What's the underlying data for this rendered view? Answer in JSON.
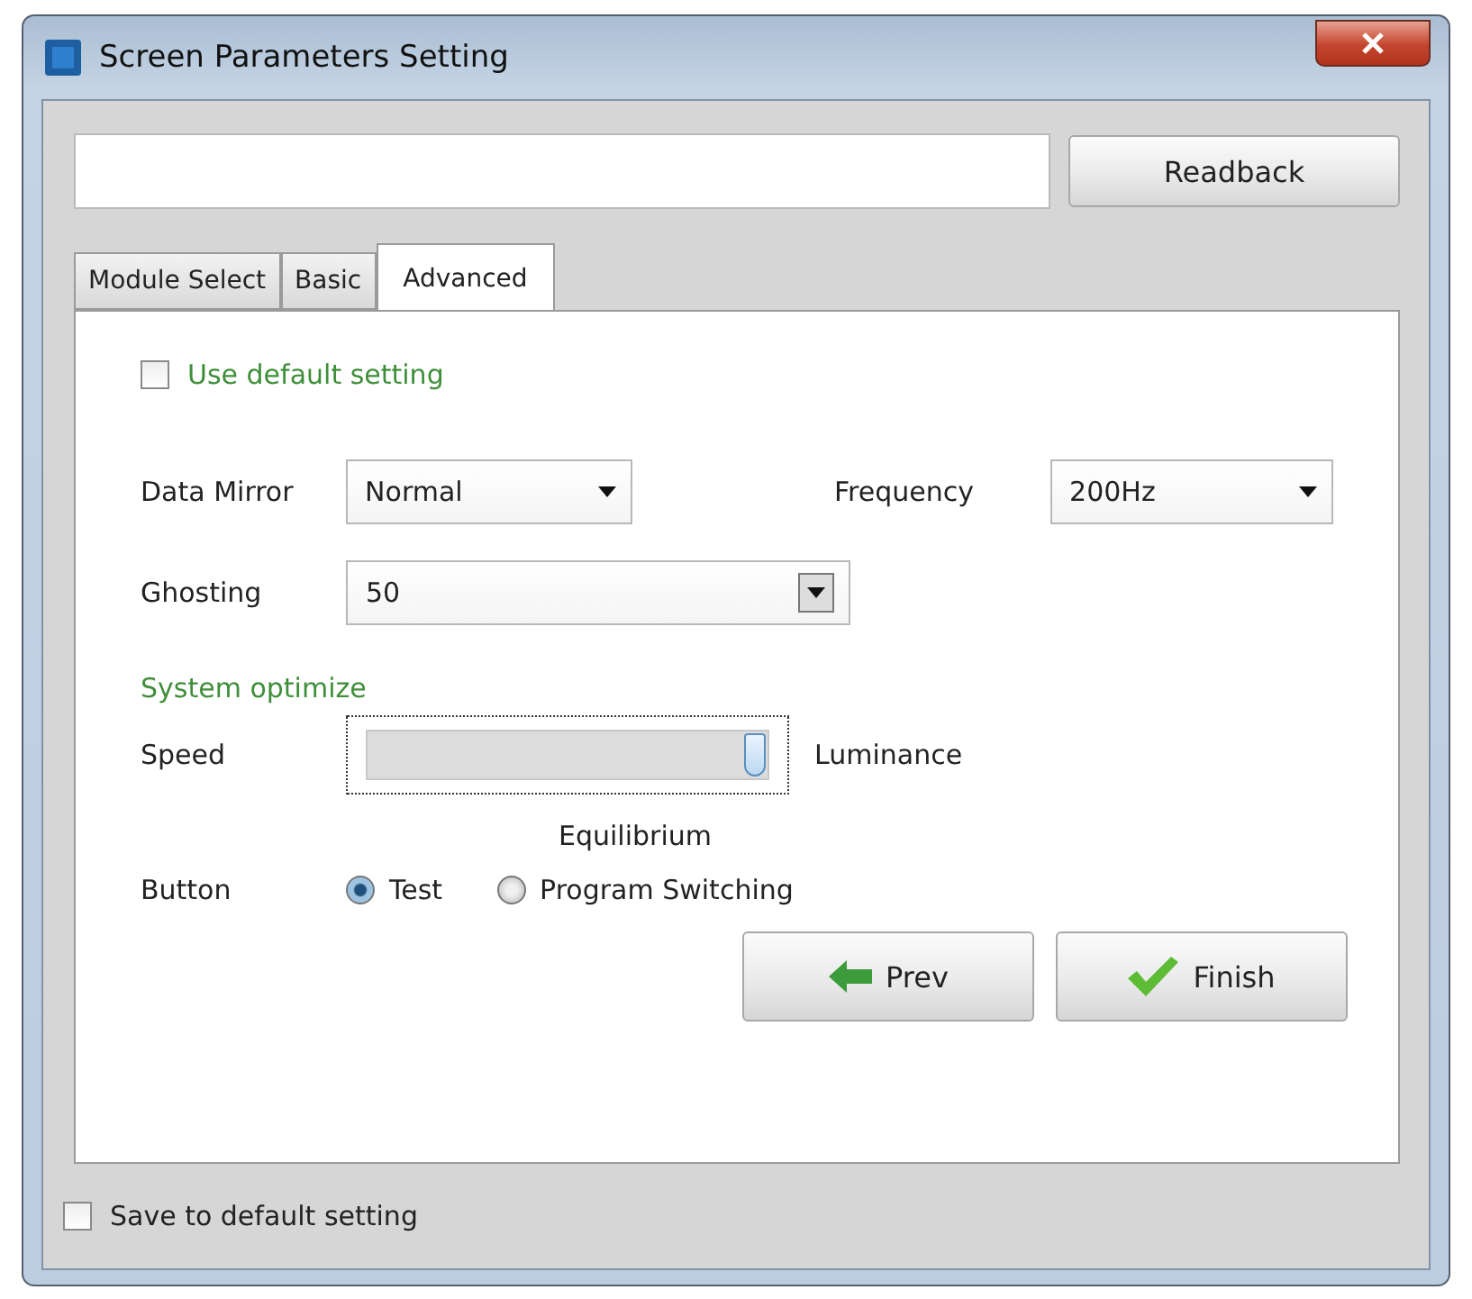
{
  "window": {
    "title": "Screen Parameters Setting"
  },
  "top": {
    "button": "Readback"
  },
  "tabs": [
    {
      "label": "Module Select",
      "selected": false
    },
    {
      "label": "Basic",
      "selected": false
    },
    {
      "label": "Advanced",
      "selected": true
    }
  ],
  "use_default": {
    "label": "Use default setting",
    "checked": false
  },
  "data_mirror": {
    "label": "Data Mirror",
    "value": "Normal"
  },
  "frequency": {
    "label": "Frequency",
    "value": "200Hz"
  },
  "ghosting": {
    "label": "Ghosting",
    "value": "50"
  },
  "system_optimize": {
    "heading": "System optimize",
    "left_label": "Speed",
    "right_label": "Luminance",
    "middle_label": "Equilibrium",
    "level": 0.97
  },
  "button_mode": {
    "label": "Button",
    "options": [
      {
        "label": "Test",
        "selected": true
      },
      {
        "label": "Program Switching",
        "selected": false
      }
    ]
  },
  "nav_buttons": [
    {
      "label": "Prev",
      "kind": "prev"
    },
    {
      "label": "Finish",
      "kind": "finish"
    }
  ],
  "save_default": {
    "label": "Save to default setting",
    "checked": false
  }
}
